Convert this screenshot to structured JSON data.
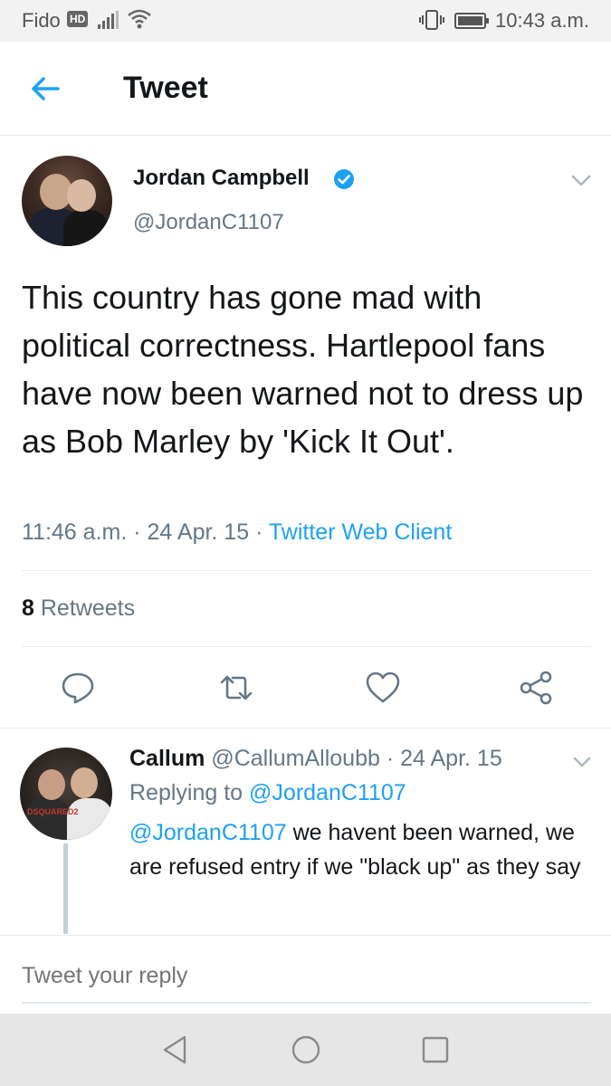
{
  "status_bar": {
    "carrier": "Fido",
    "hd": "HD",
    "time": "10:43 a.m."
  },
  "header": {
    "title": "Tweet",
    "back_icon": "arrow-left-icon"
  },
  "tweet": {
    "author_name": "Jordan Campbell",
    "author_handle": "@JordanC1107",
    "verified": true,
    "text": "This country has gone mad with political correctness. Hartlepool fans have now been warned not to dress up as Bob Marley by 'Kick It Out'.",
    "time": "11:46 a.m.",
    "date": "24 Apr. 15",
    "source": "Twitter Web Client",
    "retweet_count": "8",
    "retweet_label": "Retweets"
  },
  "actions": {
    "reply_icon": "reply-icon",
    "retweet_icon": "retweet-icon",
    "like_icon": "heart-icon",
    "share_icon": "share-icon"
  },
  "reply": {
    "name": "Callum",
    "handle": "@CallumAlloubb",
    "date": "24 Apr. 15",
    "replying_prefix": "Replying to",
    "replying_to": "@JordanC1107",
    "mention": "@JordanC1107",
    "text": " we havent been warned, we are refused entry if we \"black up\" as they say"
  },
  "composer": {
    "placeholder": "Tweet your reply"
  },
  "colors": {
    "accent": "#1da1f2",
    "secondary_text": "#657786",
    "primary_text": "#14171a"
  }
}
